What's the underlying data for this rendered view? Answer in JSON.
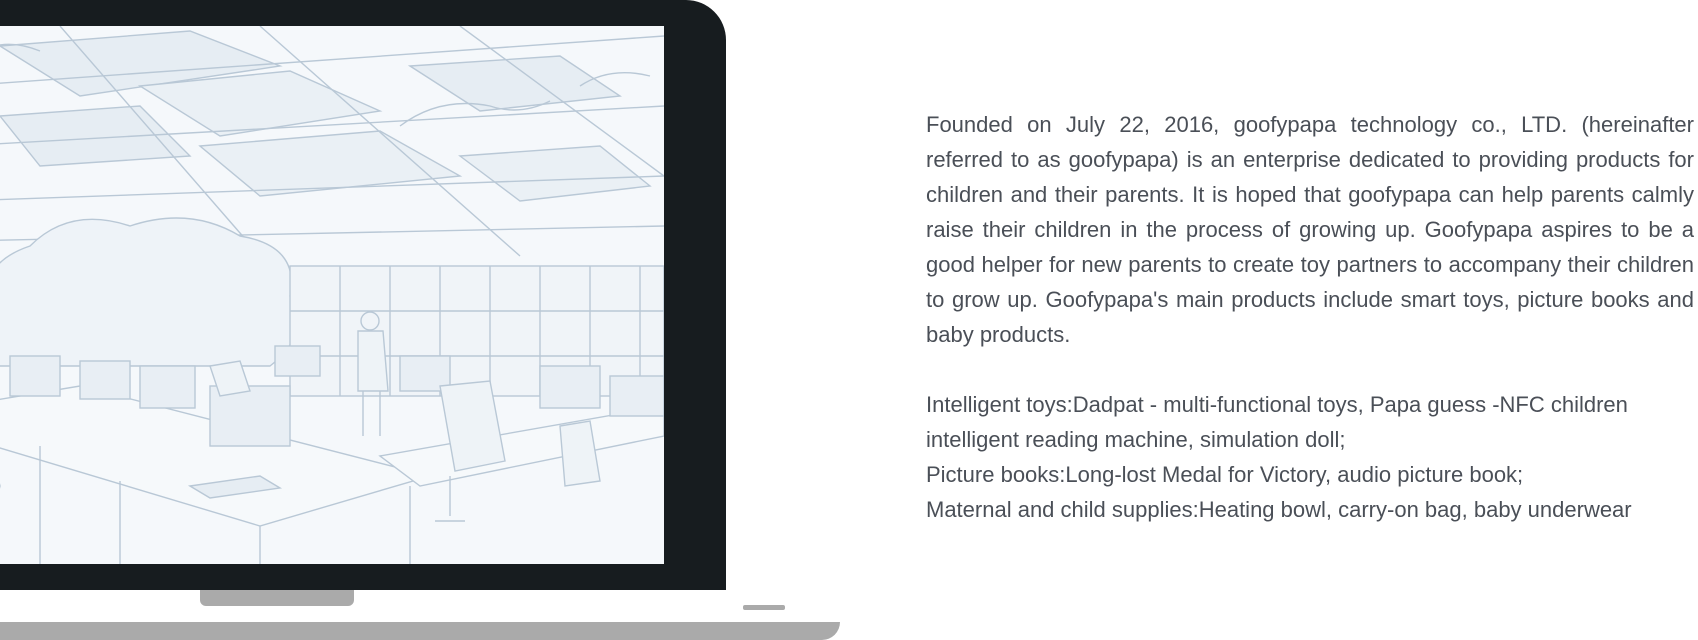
{
  "about": {
    "intro": "Founded on July 22, 2016, goofypapa technology co., LTD. (hereinafter referred to as goofypapa) is an enterprise dedicated to providing products for children and their parents. It is hoped that goofypapa can help parents calmly raise their children in the process of growing up. Goofypapa aspires to be a good helper for new parents to create toy partners to accompany their children to grow up. Goofypapa's main products include smart toys, picture books and baby products.",
    "products": [
      "Intelligent toys:Dadpat - multi-functional toys, Papa guess -NFC children intelligent reading machine, simulation doll;",
      "Picture books:Long-lost Medal for Victory, audio picture book;",
      "Maternal and child supplies:Heating bowl, carry-on bag, baby underwear"
    ]
  },
  "colors": {
    "bezel": "#171c1f",
    "base": "#aaaaaa",
    "text": "#4a4f57",
    "screen_sketch": "#b9c8d6"
  },
  "icons": {
    "laptop": "laptop-illustration",
    "screen": "office-sketch-image"
  }
}
